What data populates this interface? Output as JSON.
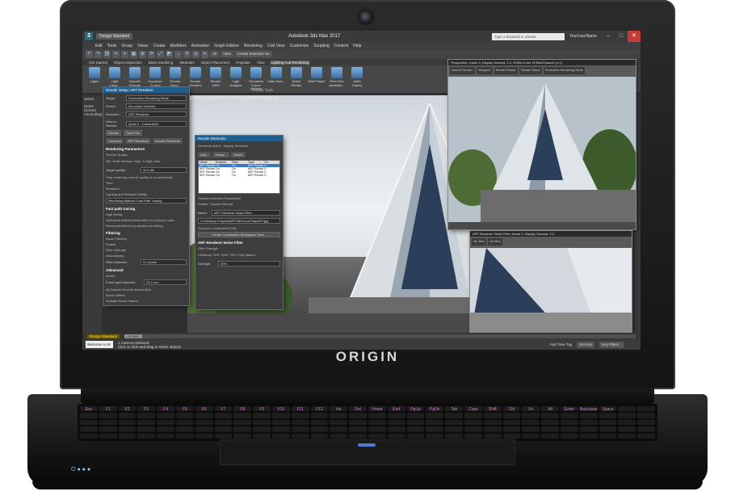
{
  "device": {
    "brand_logo": "ORIGIN",
    "keyboard_labels": [
      "Esc",
      "F1",
      "F2",
      "F3",
      "F4",
      "F5",
      "F6",
      "F7",
      "F8",
      "F9",
      "F10",
      "F11",
      "F12",
      "Ins",
      "Del",
      "Home",
      "End",
      "PgUp",
      "PgDn",
      "Tab",
      "Caps Lock",
      "Shift",
      "Ctrl",
      "Fn",
      "Alt",
      "Enter",
      "Backspace",
      "Space"
    ]
  },
  "app": {
    "icon_letter": "3",
    "workspace": "Design Standard",
    "window_title": "Autodesk 3ds Max 2017",
    "search_placeholder": "Type a keyword or phrase",
    "user": "YourUserName",
    "menu": [
      "Edit",
      "Tools",
      "Group",
      "Views",
      "Create",
      "Modifiers",
      "Animation",
      "Graph Editors",
      "Rendering",
      "Civil View",
      "Customize",
      "Scripting",
      "Content",
      "Help"
    ],
    "toolbar_dropdowns": [
      "All",
      "View",
      "Create Selection Se"
    ],
    "ribbon_tabs": [
      "Get Started",
      "Object Inspection",
      "Basic Modeling",
      "Materials",
      "Object Placement",
      "Populate",
      "View",
      "Lighting And Rendering"
    ],
    "ribbon_buttons": [
      "Lights",
      "Light Lister...",
      "Include/ Exclude",
      "Exposure Control",
      "Render Setup...",
      "Render Rendere",
      "Render A360",
      "Light Analysis",
      "Rendered Frame Window",
      "State Sets...",
      "Batch Render",
      "RAM Player",
      "Print Size Assistant...",
      "A360 Gallery"
    ],
    "ribbon_group_label": "Render Tools",
    "viewport_label": "[+] [Camera001] [User Defined] [Default Shading]",
    "left_strip_labels": [
      "Select",
      "Name (Sorted Ascending)"
    ],
    "colors": {
      "accent_blue": "#1f5f8f",
      "workspace_badge_bg": "#6b5b00",
      "close_red": "#c73a3a",
      "keyboard_legend": "#d87bd8",
      "touchpad_led": "#4b7bd1"
    }
  },
  "render_setup": {
    "title": "Render Setup: ART Renderer",
    "fields": [
      {
        "label": "Target:",
        "value": "Production Rendering Mode"
      },
      {
        "label": "Preset:",
        "value": "No preset selected"
      },
      {
        "label": "Renderer:",
        "value": "ART Renderer"
      },
      {
        "label": "View to Render:",
        "value": "Quad 4 - Camera001"
      }
    ],
    "render_button": "Render",
    "save_file": "Save File",
    "tabs": [
      "Common",
      "ART Renderer",
      "Render Elements"
    ],
    "sections": {
      "rendering_parameters": "Rendering Parameters",
      "render_quality": "Render Quality",
      "quality_levels": [
        "Min",
        "Draft",
        "Medium",
        "High",
        "X-High",
        "Max"
      ],
      "target_quality": "Target quality:",
      "target_quality_value": "20.0 dB",
      "stop_line": "Stop rendering once (if quality is not achieved):",
      "time_label": "Time",
      "iterations_label": "Iterations",
      "lighting": "Lighting and Material Fidelity",
      "rendering_method": "Rendering Method: Fast Path Tracing",
      "fast_path": "Fast path tracing",
      "fp_opts": [
        "High fidelity",
        "Optimized indirect illumination for reduced noise",
        "Recommended for production rendering"
      ],
      "filtering": "Filtering",
      "noise_filtering": "Noise Filtering",
      "enable": "Enable",
      "filter_strength": "Filter Strength",
      "antialiasing": "Anti-Aliasing",
      "filter_diameter": "Filter Diameter:",
      "filter_diameter_value": "3.0 pixels",
      "advanced": "Advanced",
      "scene": "Scene",
      "point_light_diameter": "Point Light Diameter:",
      "point_light_value": "25.4 mm",
      "motion_blur": "All Objects Receive Motion Blur",
      "noise_pattern": "Noise Pattern",
      "animate_noise": "Animate Noise Pattern"
    }
  },
  "render_elements": {
    "title": "Render Elements",
    "elements_active": "Elements Active",
    "display_elements": "Display Elements",
    "buttons": [
      "Add...",
      "Merge...",
      "Delete"
    ],
    "columns": [
      "Name",
      "Enabled",
      "Filter",
      "Type",
      "Ou"
    ],
    "rows": [
      [
        "ART Renderer N...",
        "On",
        "On",
        "ART Rendere...",
        "C:"
      ],
      [
        "ART Renderer N...",
        "On",
        "On",
        "ART Rendere...",
        "C:"
      ],
      [
        "ART Renderer N...",
        "On",
        "On",
        "ART Rendere...",
        "C:"
      ],
      [
        "ART Renderer N...",
        "On",
        "On",
        "ART Rendere...",
        "C:"
      ]
    ],
    "selected_params": "Selected Element Parameters",
    "enable": "Enable",
    "enable_filtering": "Enable Filtering",
    "name_label": "Name:",
    "name_value": "ART Renderer Noise Filter ",
    "path_value": "C:\\Desktop-Projects\\ART\\AirForceChapelFF.jpg",
    "output_combustion": "Output to Combustion(TM)",
    "create_workspace": "Create Combustion Workspace Now...",
    "noise_filter_section": "ART Renderer Noise Filter",
    "filter_strength_label": "Filter Strength",
    "strength_marks": [
      "Unfiltered",
      "25%",
      "50%",
      "75%",
      "Fully filtered"
    ],
    "strength_label": "Strength",
    "strength_value": "90%"
  },
  "frame_windows": [
    {
      "title": "Perspective, frame 0, Display Gamma: 2.2, RGBA Color 16 Bits/Channel (1:1)",
      "chips": [
        "Area to Render:",
        "Viewport:",
        "Render Preset:",
        "Render Setup",
        "Production Rendering Mode"
      ]
    },
    {
      "title": "ART Renderer Noise Filter, frame 0, Display Gamma: 2.2",
      "chips": [
        "Ver Bloc",
        "Ver Bloc"
      ]
    }
  ],
  "timeline": {
    "frame": "0 / 100"
  },
  "status": {
    "maxscript": "Welcome to M",
    "selected": "1 Camera Selected",
    "prompt": "Click or click-and-drag to select objects",
    "add_time_tag": "Add Time Tag",
    "set_key": "Set Key",
    "key_filters": "Key Filters..."
  }
}
